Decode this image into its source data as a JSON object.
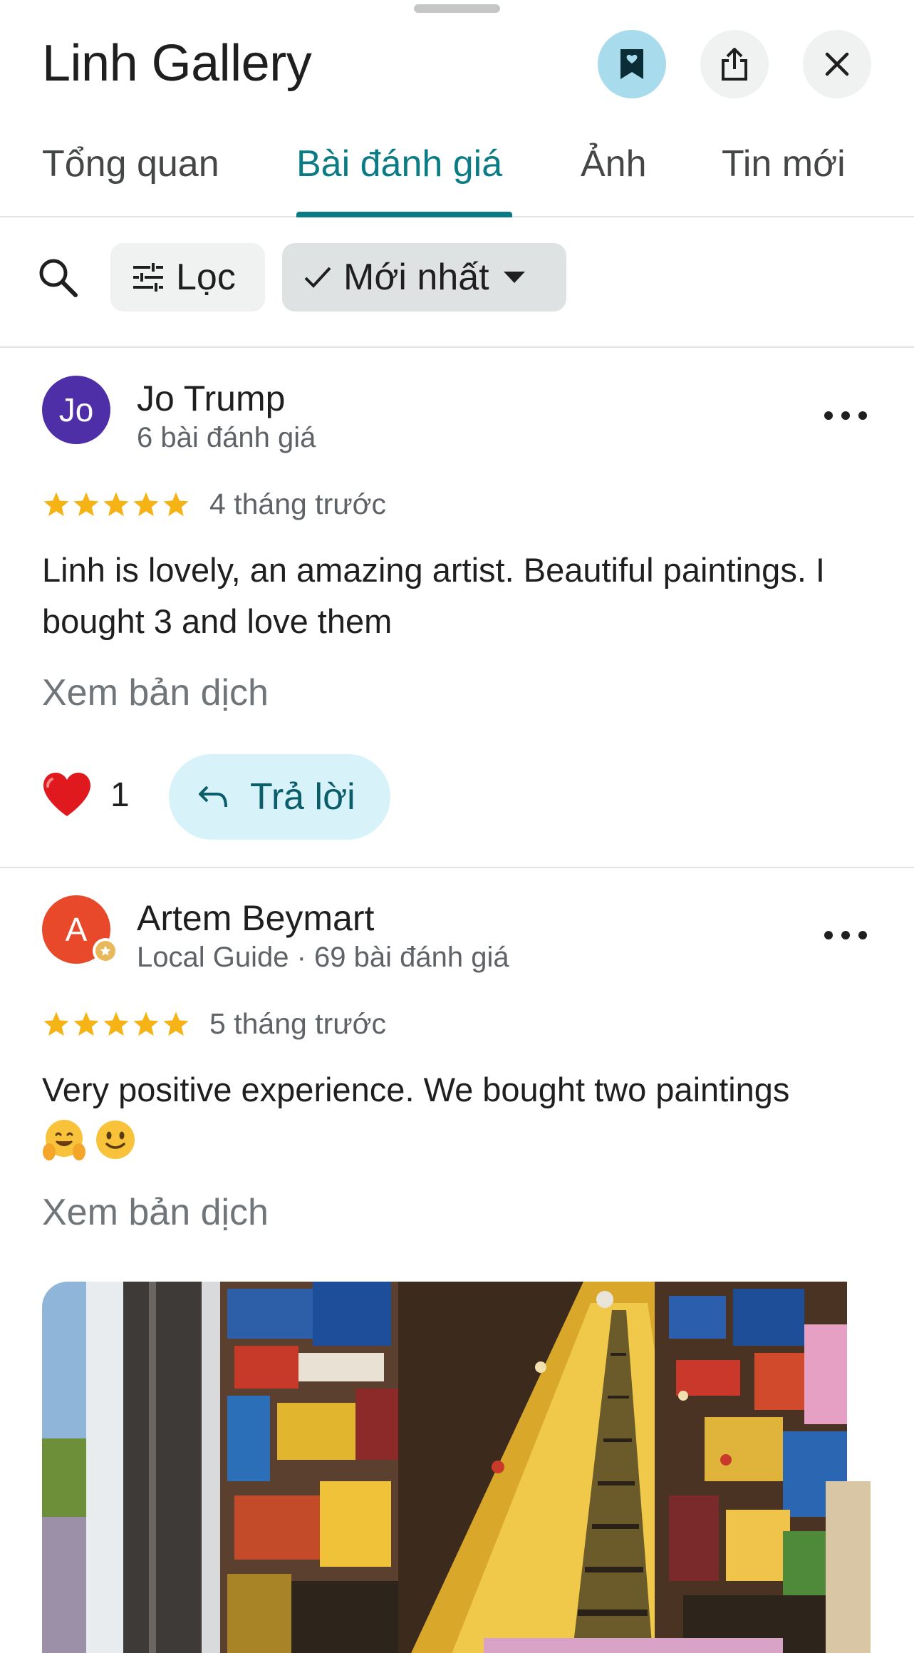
{
  "header": {
    "title": "Linh Gallery"
  },
  "tabs": [
    {
      "label": "Tổng quan",
      "active": false
    },
    {
      "label": "Bài đánh giá",
      "active": true
    },
    {
      "label": "Ảnh",
      "active": false
    },
    {
      "label": "Tin mới",
      "active": false
    }
  ],
  "filters": {
    "filter_label": "Lọc",
    "sort_label": "Mới nhất"
  },
  "reviews": [
    {
      "avatar_initials": "Jo",
      "avatar_color": "#4f2fa8",
      "name": "Jo Trump",
      "meta": "6 bài đánh giá",
      "rating": 5,
      "time": "4 tháng trước",
      "text": "Linh is lovely, an amazing artist. Beautiful paintings. I bought 3 and love them",
      "translate": "Xem bản dịch",
      "likes": "1",
      "reply_label": "Trả lời"
    },
    {
      "avatar_initials": "A",
      "avatar_color": "#e8492b",
      "name": "Artem Beymart",
      "meta": "Local Guide · 69 bài đánh giá",
      "rating": 5,
      "time": "5 tháng trước",
      "text": "Very positive experience. We bought two paintings",
      "emojis": [
        "🤗",
        "🙂"
      ],
      "translate": "Xem bản dịch"
    }
  ],
  "colors": {
    "accent": "#0b7c86",
    "star": "#f6b315"
  }
}
